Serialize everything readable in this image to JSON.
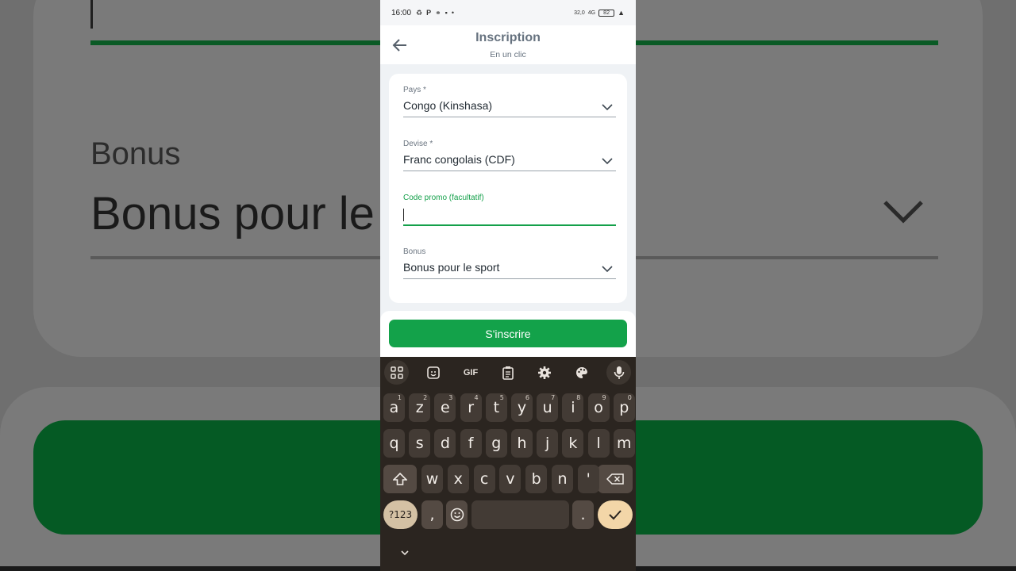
{
  "background_zoom": {
    "label": "Bonus",
    "value": "Bonus pour le"
  },
  "status_bar": {
    "time": "16:00",
    "icons": [
      "recycle-icon",
      "parking-icon",
      "link-icon",
      "camera-icon",
      "dot-icon"
    ],
    "speed": "32,0",
    "network": "4G",
    "battery": "82"
  },
  "app_bar": {
    "title": "Inscription",
    "subtitle": "En un clic"
  },
  "form": {
    "country": {
      "label": "Pays *",
      "value": "Congo (Kinshasa)"
    },
    "currency": {
      "label": "Devise *",
      "value": "Franc congolais (CDF)"
    },
    "promo": {
      "label": "Code promo (facultatif)",
      "value": ""
    },
    "bonus": {
      "label": "Bonus",
      "value": "Bonus pour le sport"
    }
  },
  "signup_button": "S'inscrire",
  "colors": {
    "accent_green": "#13a24a",
    "title_gray": "#66727f",
    "keyboard_bg": "#2b2520",
    "enter_key": "#f3d6a8"
  },
  "keyboard": {
    "toolbar": [
      "apps-icon",
      "sticker-icon",
      "GIF",
      "clipboard-icon",
      "gear-icon",
      "palette-icon",
      "microphone-icon"
    ],
    "gif_label": "GIF",
    "row1": [
      {
        "k": "a",
        "h": "1"
      },
      {
        "k": "z",
        "h": "2"
      },
      {
        "k": "e",
        "h": "3"
      },
      {
        "k": "r",
        "h": "4"
      },
      {
        "k": "t",
        "h": "5"
      },
      {
        "k": "y",
        "h": "6"
      },
      {
        "k": "u",
        "h": "7"
      },
      {
        "k": "i",
        "h": "8"
      },
      {
        "k": "o",
        "h": "9"
      },
      {
        "k": "p",
        "h": "0"
      }
    ],
    "row2": [
      "q",
      "s",
      "d",
      "f",
      "g",
      "h",
      "j",
      "k",
      "l",
      "m"
    ],
    "row3": [
      "w",
      "x",
      "c",
      "v",
      "b",
      "n",
      "'"
    ],
    "sym_label": "?123",
    "comma": ",",
    "period": "."
  }
}
